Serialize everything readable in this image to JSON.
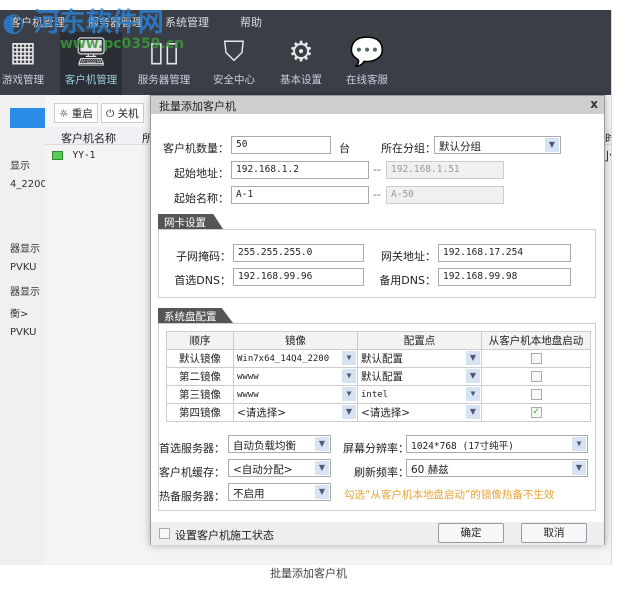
{
  "watermark": {
    "name": "河东软件网",
    "url": "www.pc0359.cn"
  },
  "menu": [
    "客户机管理",
    "服务器管理",
    "系统管理",
    "帮助"
  ],
  "nav": [
    {
      "label": "游戏管理",
      "icon": "gamepad-icon"
    },
    {
      "label": "客户机管理",
      "icon": "monitor-tools-icon",
      "active": true
    },
    {
      "label": "服务器管理",
      "icon": "server-icon"
    },
    {
      "label": "安全中心",
      "icon": "shield-icon"
    },
    {
      "label": "基本设置",
      "icon": "gear-icon"
    },
    {
      "label": "在线客服",
      "icon": "chat-icon"
    }
  ],
  "sidebar": [
    "显示",
    "4_2200",
    "器显示",
    "PVKU",
    "器显示",
    "衡>",
    "PVKU"
  ],
  "toolbar": {
    "restart": "重启",
    "shutdown": "关机"
  },
  "table": {
    "headers": [
      "客户机名称",
      "所",
      "时"
    ],
    "rows": [
      {
        "name": "YY-1",
        "extra": "小"
      }
    ]
  },
  "dialog": {
    "title": "批量添加客户机",
    "close": "x",
    "count_label": "客户机数量：",
    "count": "50",
    "count_unit": "台",
    "group_label": "所在分组：",
    "group": "默认分组",
    "start_ip_label": "起始地址：",
    "start_ip": "192.168.1.2",
    "end_ip": "192.168.1.51",
    "start_name_label": "起始名称：",
    "start_name": "A-1",
    "end_name": "A-50",
    "dash": "--",
    "nic": {
      "title": "网卡设置",
      "mask_label": "子网掩码：",
      "mask": "255.255.255.0",
      "gateway_label": "网关地址：",
      "gateway": "192.168.17.254",
      "dns1_label": "首选DNS：",
      "dns1": "192.168.99.96",
      "dns2_label": "备用DNS：",
      "dns2": "192.168.99.98"
    },
    "disk": {
      "title": "系统盘配置",
      "headers": [
        "顺序",
        "镜像",
        "配置点",
        "从客户机本地盘启动"
      ],
      "rows": [
        {
          "order": "默认镜像",
          "image": "Win7x64_14Q4_2200",
          "config": "默认配置",
          "local": false
        },
        {
          "order": "第二镜像",
          "image": "wwww",
          "config": "默认配置",
          "local": false
        },
        {
          "order": "第三镜像",
          "image": "wwww",
          "config": "intel",
          "local": false
        },
        {
          "order": "第四镜像",
          "image": "<请选择>",
          "config": "<请选择>",
          "local": true
        }
      ],
      "server_label": "首选服务器：",
      "server": "自动负载均衡",
      "resolution_label": "屏幕分辨率：",
      "resolution": "1024*768 (17寸纯平)",
      "cache_label": "客户机缓存：",
      "cache": "<自动分配>",
      "refresh_label": "刷新频率：",
      "refresh": "60 赫兹",
      "hot_label": "热备服务器：",
      "hot": "不启用",
      "warning": "勾选“从客户机本地盘启动”的镜像热备不生效"
    },
    "construction_label": "设置客户机施工状态",
    "ok": "确定",
    "cancel": "取消"
  },
  "caption": "批量添加客户机",
  "colors": {
    "topbar": "#3a3e46",
    "warning": "#e8a33a",
    "accent": "#2a8ee8"
  }
}
